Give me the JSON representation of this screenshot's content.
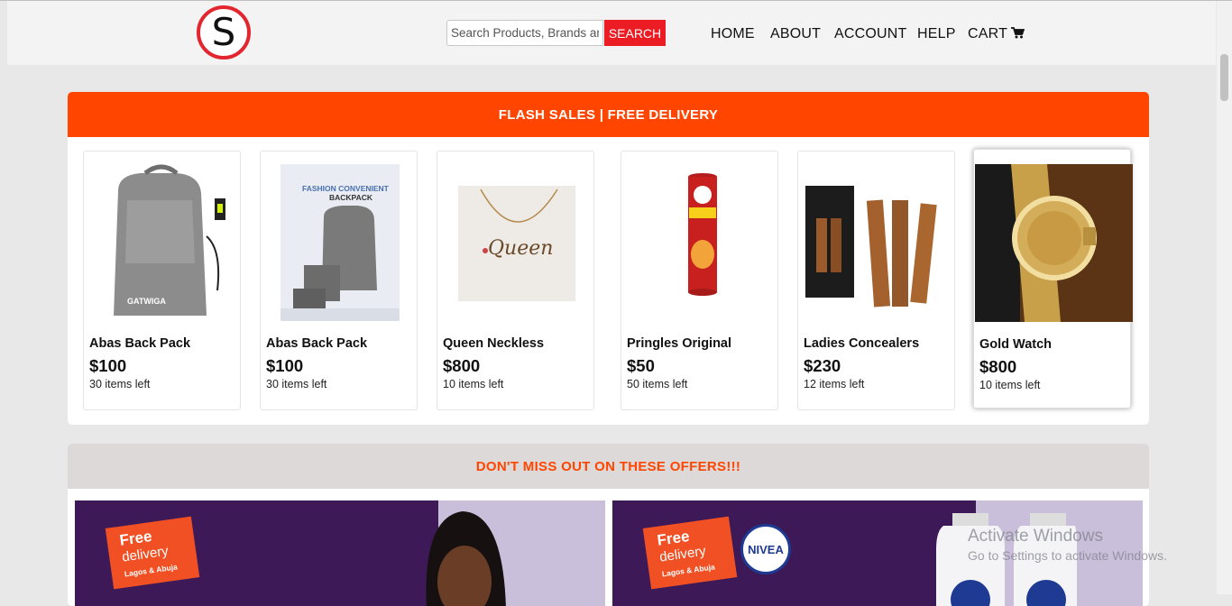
{
  "header": {
    "logo_letter": "S",
    "search": {
      "placeholder": "Search Products, Brands and Categories",
      "button": "SEARCH"
    },
    "nav": {
      "home": "HOME",
      "about": "ABOUT",
      "account": "ACCOUNT",
      "help": "HELP",
      "cart": "CART"
    }
  },
  "flash": {
    "title": "FLASH SALES | FREE DELIVERY",
    "products": [
      {
        "name": "Abas Back Pack",
        "price": "$100",
        "stock": "30 items left"
      },
      {
        "name": "Abas Back Pack",
        "price": "$100",
        "stock": "30 items left"
      },
      {
        "name": "Queen Neckless",
        "price": "$800",
        "stock": "10 items left"
      },
      {
        "name": "Pringles Original",
        "price": "$50",
        "stock": "50 items left"
      },
      {
        "name": "Ladies Concealers",
        "price": "$230",
        "stock": "12 items left"
      },
      {
        "name": "Gold Watch",
        "price": "$800",
        "stock": "10 items left"
      }
    ]
  },
  "offers": {
    "title": "DON'T MISS OUT ON THESE OFFERS!!!",
    "banners": [
      {
        "tag_line1": "Free",
        "tag_line2": "delivery",
        "tag_line3": "Lagos & Abuja"
      },
      {
        "tag_line1": "Free",
        "tag_line2": "delivery",
        "tag_line3": "Lagos & Abuja",
        "brand": "NIVEA"
      }
    ]
  },
  "watermark": {
    "line1": "Activate Windows",
    "line2": "Go to Settings to activate Windows."
  },
  "colors": {
    "accent": "#ff4500",
    "search_button": "#ec1c24",
    "logo_ring": "#e3262e",
    "banner_purple": "#3d1a57"
  },
  "icons": {
    "cart": "shopping-cart-icon"
  }
}
